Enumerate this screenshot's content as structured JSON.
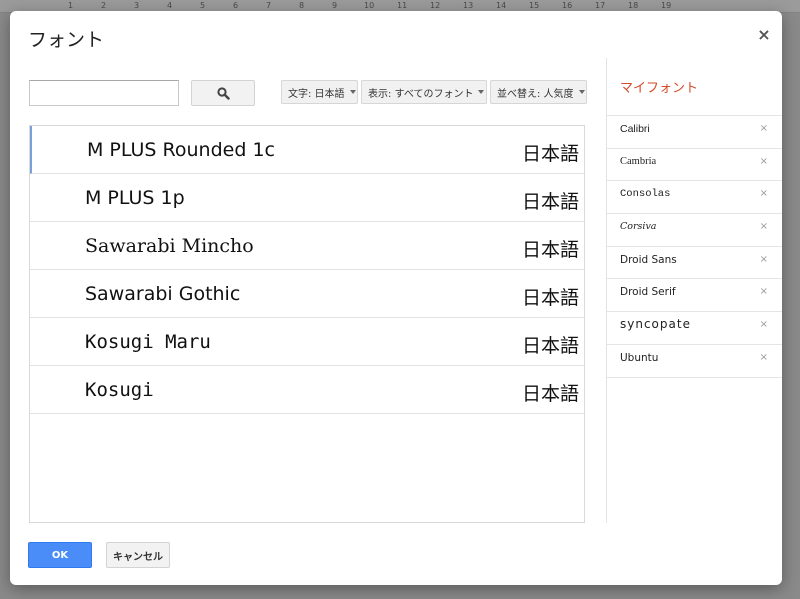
{
  "ruler": [
    "1",
    "2",
    "3",
    "4",
    "5",
    "6",
    "7",
    "8",
    "9",
    "10",
    "11",
    "12",
    "13",
    "14",
    "15",
    "16",
    "17",
    "18",
    "19"
  ],
  "dialog": {
    "title": "フォント",
    "close_label": "×"
  },
  "search": {
    "value": "",
    "placeholder": ""
  },
  "filters": {
    "script": "文字: 日本語",
    "show": "表示: すべてのフォント",
    "sort": "並べ替え: 人気度"
  },
  "fonts": [
    {
      "name": "M PLUS Rounded 1c",
      "sample": "日本語"
    },
    {
      "name": "M PLUS 1p",
      "sample": "日本語"
    },
    {
      "name": "Sawarabi Mincho",
      "sample": "日本語"
    },
    {
      "name": "Sawarabi Gothic",
      "sample": "日本語"
    },
    {
      "name": "Kosugi Maru",
      "sample": "日本語"
    },
    {
      "name": "Kosugi",
      "sample": "日本語"
    }
  ],
  "my_fonts": {
    "title": "マイフォント",
    "items": [
      {
        "name": "Calibri",
        "remove": "×"
      },
      {
        "name": "Cambria",
        "remove": "×"
      },
      {
        "name": "Consolas",
        "remove": "×"
      },
      {
        "name": "Corsiva",
        "remove": "×"
      },
      {
        "name": "Droid Sans",
        "remove": "×"
      },
      {
        "name": "Droid Serif",
        "remove": "×"
      },
      {
        "name": "syncopate",
        "remove": "×"
      },
      {
        "name": "Ubuntu",
        "remove": "×"
      }
    ]
  },
  "buttons": {
    "ok": "OK",
    "cancel": "キャンセル"
  },
  "colors": {
    "accent_red": "#d44a2a",
    "ok_blue": "#4a8df8",
    "selected_border": "#7aa0d8"
  }
}
